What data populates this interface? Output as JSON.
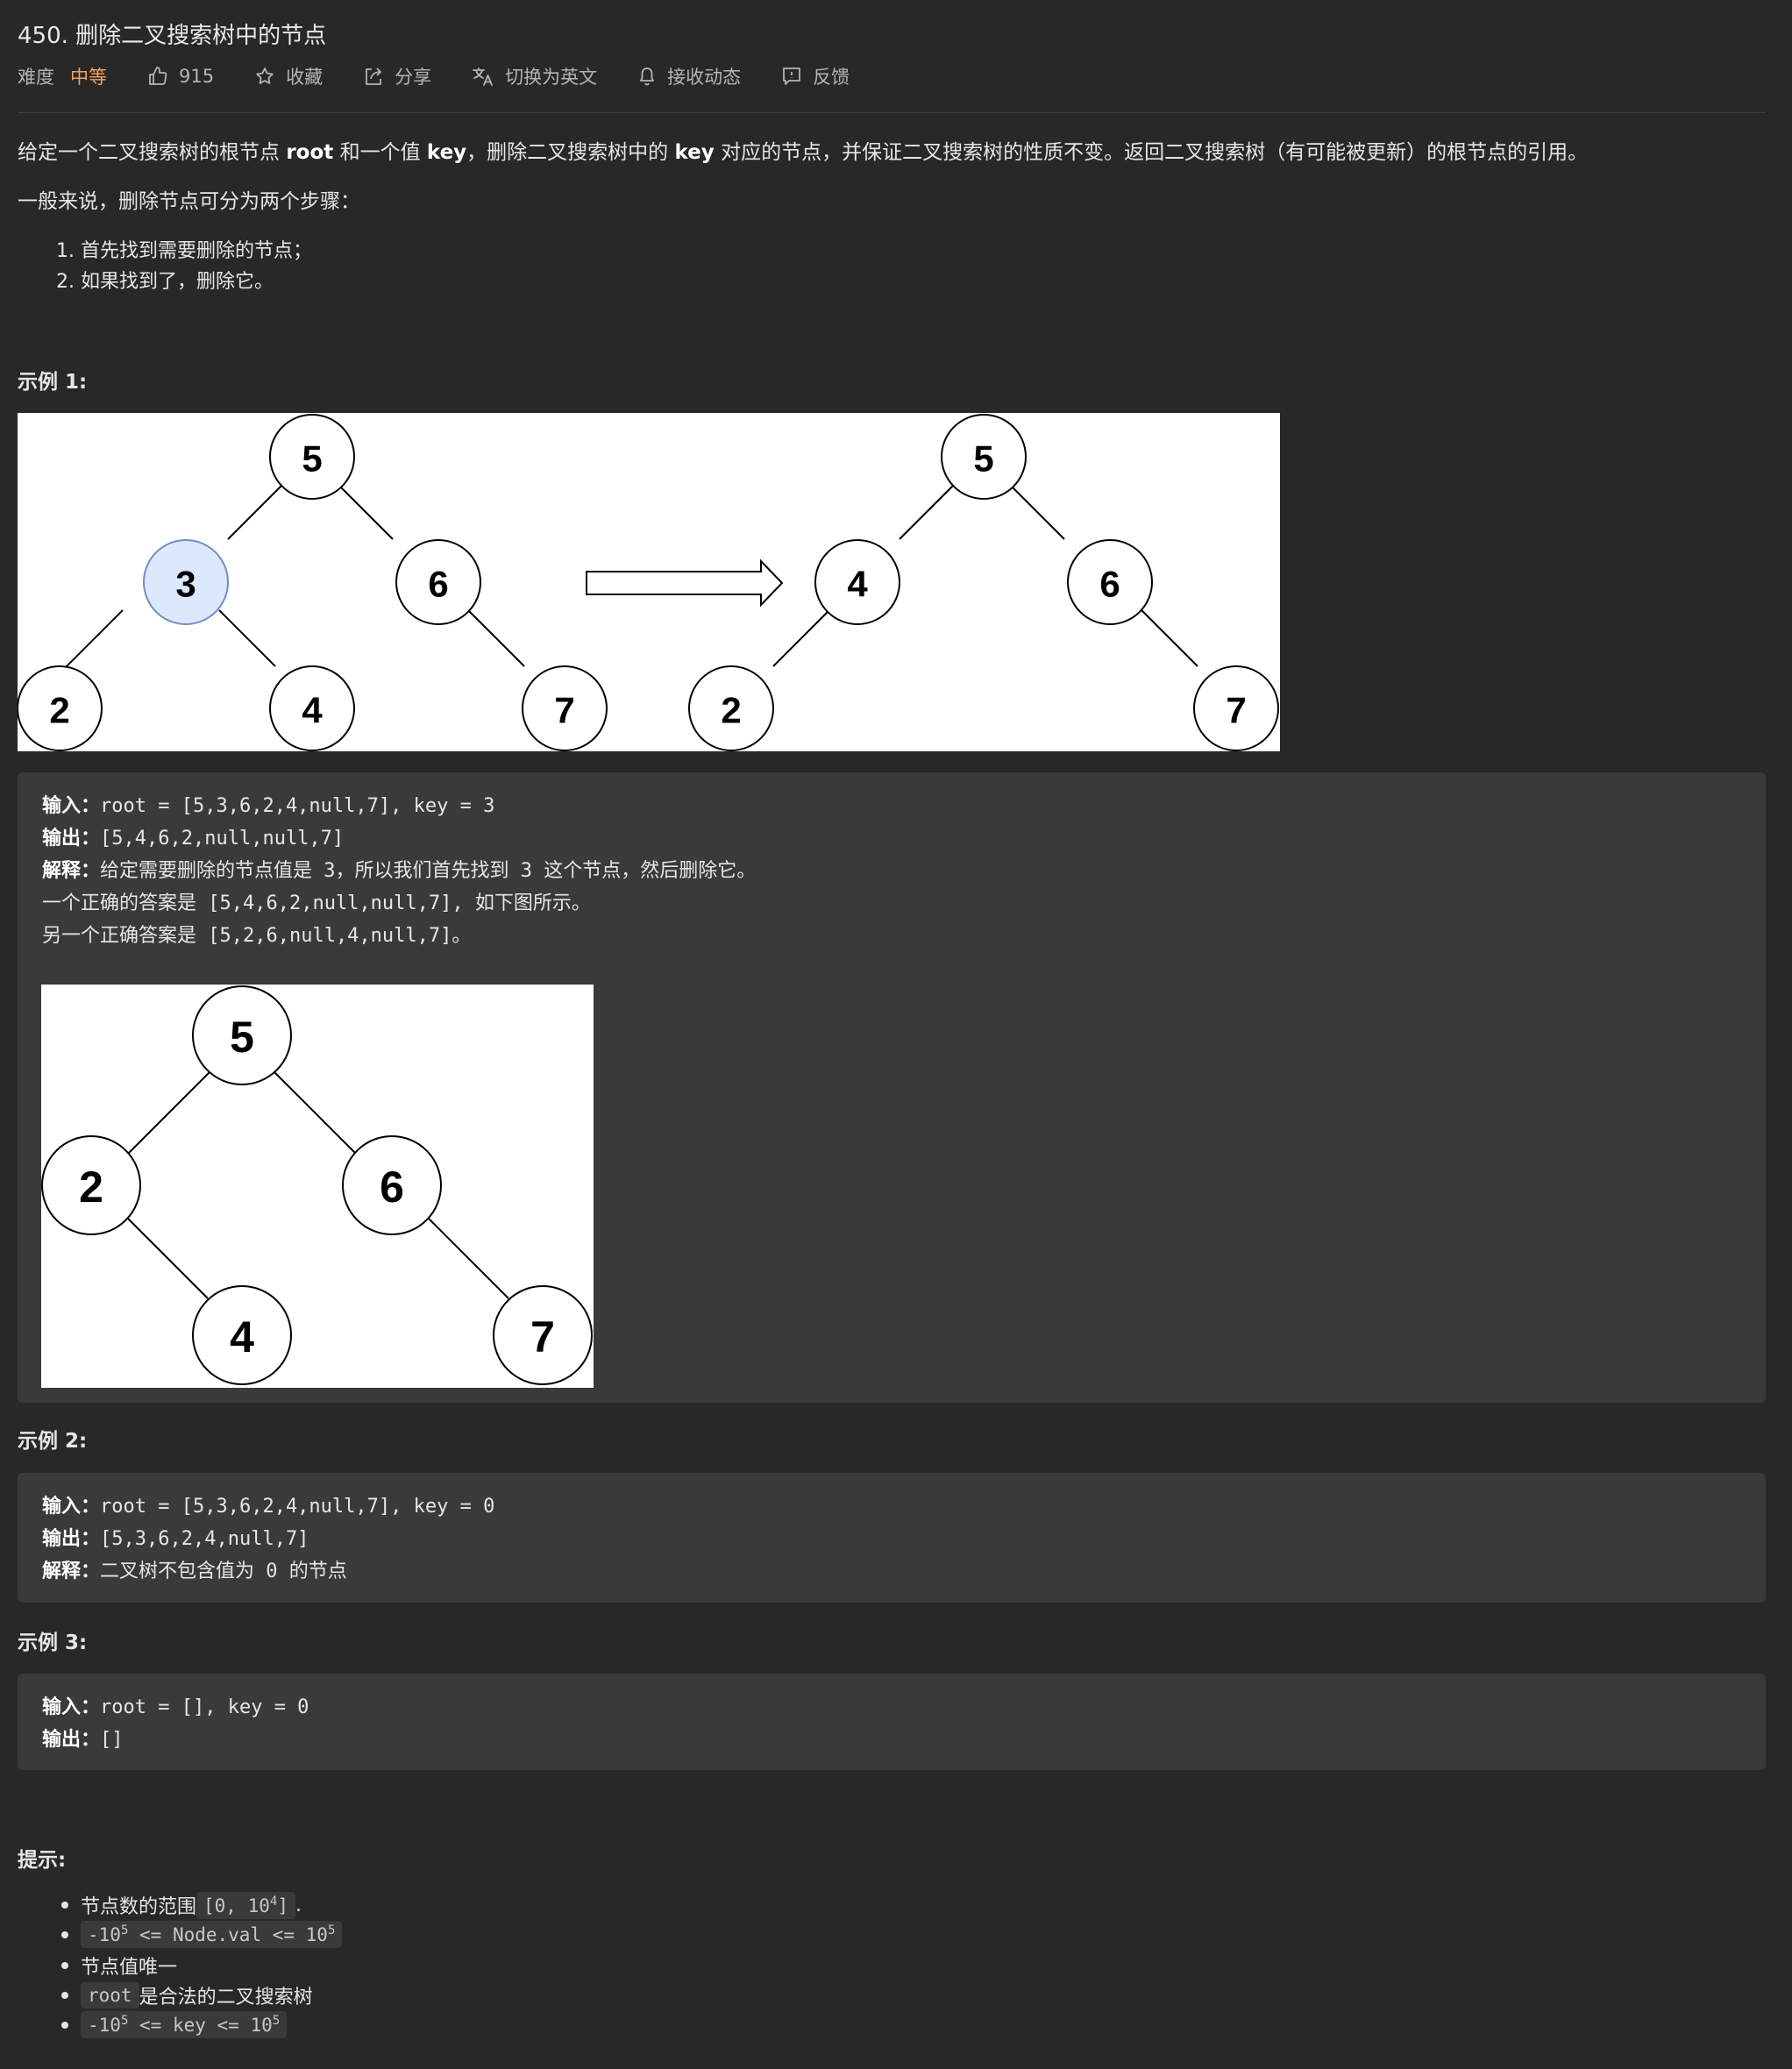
{
  "problem": {
    "title": "450. 删除二叉搜索树中的节点",
    "difficulty_label": "难度",
    "difficulty": "中等",
    "likes": "915",
    "collect": "收藏",
    "share": "分享",
    "switch_lang": "切换为英文",
    "subscribe": "接收动态",
    "feedback": "反馈"
  },
  "description": {
    "p1_a": "给定一个二叉搜索树的根节点 ",
    "p1_root": "root",
    "p1_b": " 和一个值 ",
    "p1_key": "key",
    "p1_c": "，删除二叉搜索树中的 ",
    "p1_key2": "key",
    "p1_d": " 对应的节点，并保证二叉搜索树的性质不变。返回二叉搜索树（有可能被更新）的根节点的引用。",
    "p2": "一般来说，删除节点可分为两个步骤：",
    "steps": [
      "1. 首先找到需要删除的节点；",
      "2. 如果找到了，删除它。"
    ]
  },
  "example1": {
    "heading": "示例 1:",
    "tree_before": [
      "5",
      "3",
      "6",
      "2",
      "4",
      "7"
    ],
    "tree_after": [
      "5",
      "4",
      "6",
      "2",
      "7"
    ],
    "input_label": "输入：",
    "input": "root = [5,3,6,2,4,null,7], key = 3",
    "output_label": "输出：",
    "output": "[5,4,6,2,null,null,7]",
    "explain_label": "解释：",
    "explain": "给定需要删除的节点值是 3，所以我们首先找到 3 这个节点，然后删除它。",
    "line4": "一个正确的答案是 [5,4,6,2,null,null,7], 如下图所示。",
    "line5": "另一个正确答案是 [5,2,6,null,4,null,7]。",
    "tree_alt": [
      "5",
      "2",
      "6",
      "4",
      "7"
    ]
  },
  "example2": {
    "heading": "示例 2:",
    "input_label": "输入：",
    "input": "root = [5,3,6,2,4,null,7], key = 0",
    "output_label": "输出：",
    "output": "[5,3,6,2,4,null,7]",
    "explain_label": "解释：",
    "explain": "二叉树不包含值为 0 的节点"
  },
  "example3": {
    "heading": "示例 3:",
    "input_label": "输入：",
    "input": "root = [], key = 0",
    "output_label": "输出：",
    "output": "[]"
  },
  "hints": {
    "heading": "提示:",
    "h1_text": "节点数的范围 ",
    "h1_code_a": "[0, 10",
    "h1_sup": "4",
    "h1_code_b": "]",
    "h1_tail": ".",
    "h2_a": "-10",
    "h2_sup1": "5",
    "h2_b": " <= Node.val <= 10",
    "h2_sup2": "5",
    "h3": "节点值唯一",
    "h4_code": "root",
    "h4_text": " 是合法的二叉搜索树",
    "h5_a": "-10",
    "h5_sup1": "5",
    "h5_b": " <= key <= 10",
    "h5_sup2": "5"
  },
  "colors": {
    "accent_difficulty": "#f0a35e",
    "highlight_node": "#dce8fb"
  }
}
